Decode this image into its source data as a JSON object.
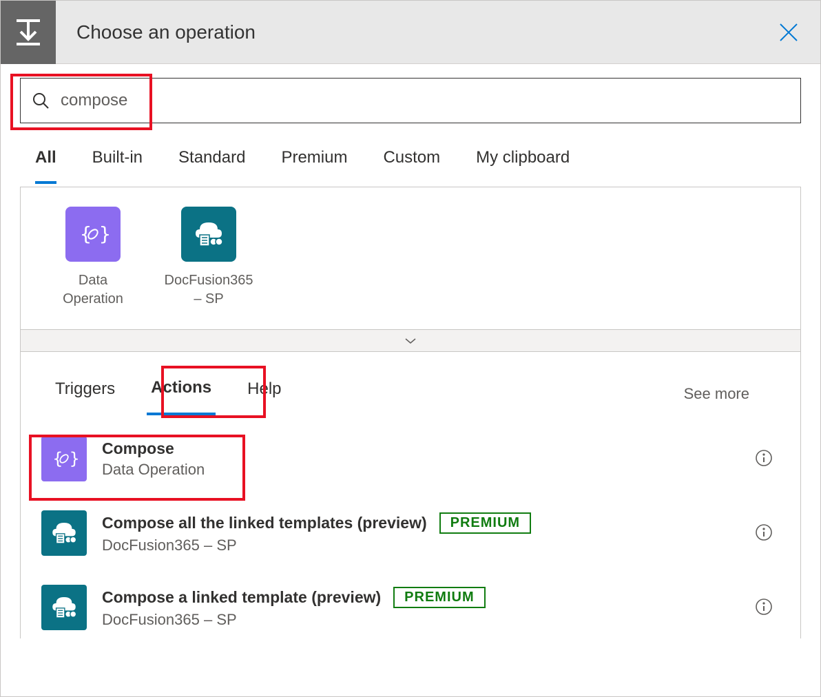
{
  "header": {
    "title": "Choose an operation"
  },
  "search": {
    "value": "compose"
  },
  "categoryTabs": [
    "All",
    "Built-in",
    "Standard",
    "Premium",
    "Custom",
    "My clipboard"
  ],
  "activeCategory": "All",
  "connectors": [
    {
      "label": "Data Operation",
      "iconType": "purple"
    },
    {
      "label": "DocFusion365 – SP",
      "iconType": "teal"
    }
  ],
  "opsTabs": [
    "Triggers",
    "Actions",
    "Help"
  ],
  "activeOpsTab": "Actions",
  "seeMore": "See more",
  "actions": [
    {
      "title": "Compose",
      "subtitle": "Data Operation",
      "iconType": "purple",
      "premium": false
    },
    {
      "title": "Compose all the linked templates (preview)",
      "subtitle": "DocFusion365 – SP",
      "iconType": "teal",
      "premium": true
    },
    {
      "title": "Compose a linked template (preview)",
      "subtitle": "DocFusion365 – SP",
      "iconType": "teal",
      "premium": true
    }
  ],
  "premiumLabel": "PREMIUM"
}
